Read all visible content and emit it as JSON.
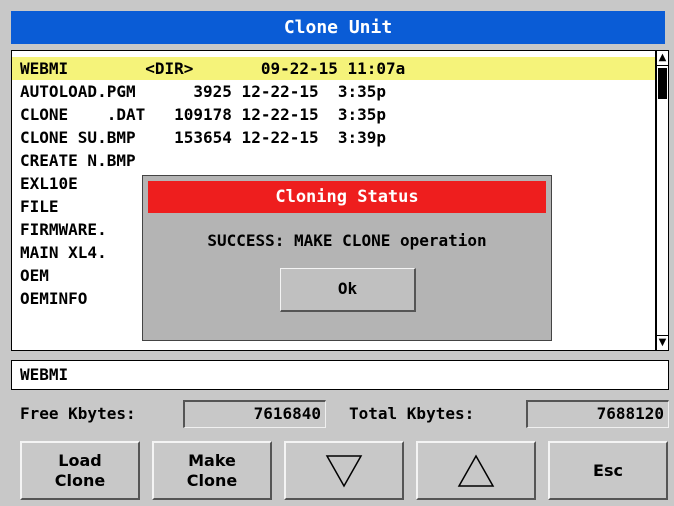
{
  "title": "Clone Unit",
  "files": [
    {
      "text": "WEBMI        <DIR>       09-22-15 11:07a"
    },
    {
      "text": "AUTOLOAD.PGM      3925 12-22-15  3:35p"
    },
    {
      "text": "CLONE    .DAT   109178 12-22-15  3:35p"
    },
    {
      "text": "CLONE SU.BMP    153654 12-22-15  3:39p"
    },
    {
      "text": "CREATE N.BMP"
    },
    {
      "text": "EXL10E"
    },
    {
      "text": "FILE"
    },
    {
      "text": "FIRMWARE."
    },
    {
      "text": "MAIN XL4."
    },
    {
      "text": "OEM"
    },
    {
      "text": "OEMINFO"
    }
  ],
  "scrollbar": {
    "up_icon": "▲",
    "down_icon": "▼"
  },
  "dialog": {
    "title": "Cloning Status",
    "message": "SUCCESS: MAKE CLONE operation",
    "ok_label": "Ok"
  },
  "current_path": "WEBMI",
  "free_label": "Free Kbytes:",
  "free_value": "7616840",
  "total_label": "Total Kbytes:",
  "total_value": "7688120",
  "buttons": {
    "load_clone": [
      "Load",
      "Clone"
    ],
    "make_clone": [
      "Make",
      "Clone"
    ],
    "down_icon": "triangle-down-icon",
    "up_icon": "triangle-up-icon",
    "esc": "Esc"
  },
  "colors": {
    "title_bar": "#0a5cd6",
    "selection": "#f5f37a",
    "dialog_title": "#ee1e1e"
  }
}
